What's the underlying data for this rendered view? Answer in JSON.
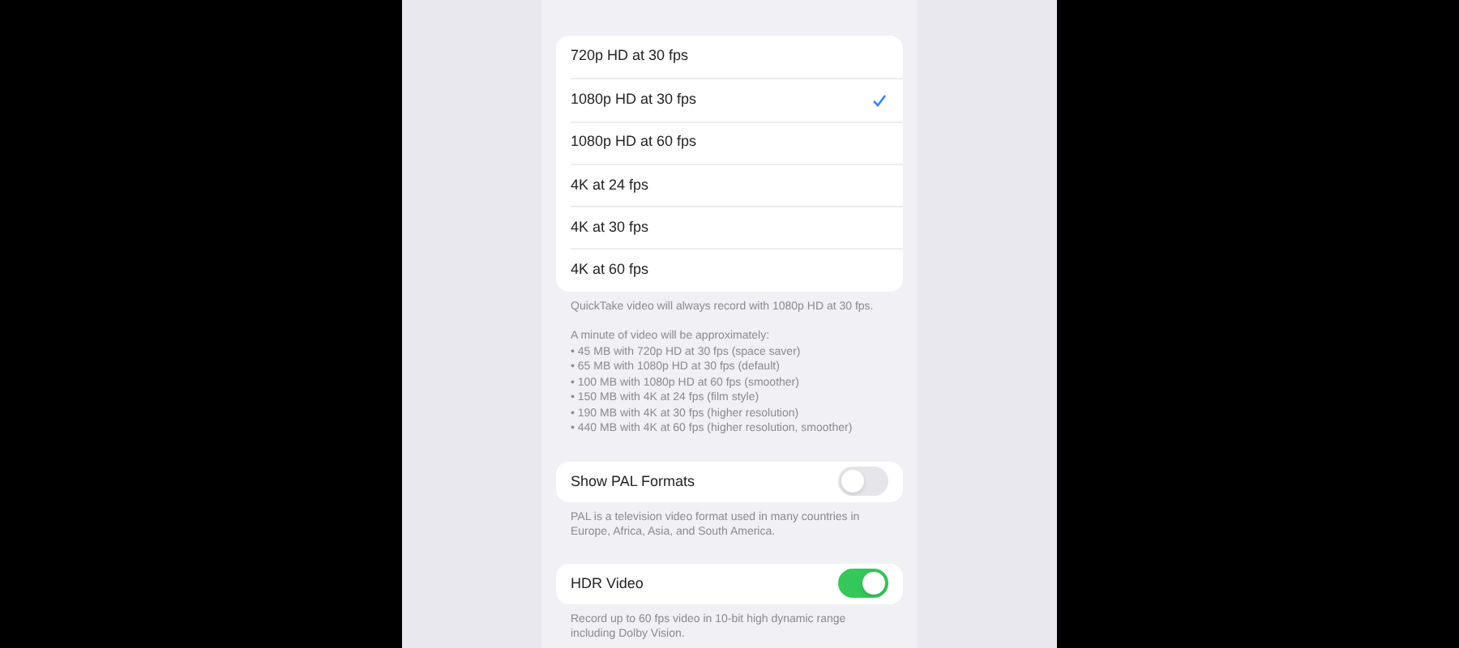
{
  "formats": [
    {
      "label": "720p HD at 30 fps",
      "selected": false
    },
    {
      "label": "1080p HD at 30 fps",
      "selected": true
    },
    {
      "label": "1080p HD at 60 fps",
      "selected": false
    },
    {
      "label": "4K at 24 fps",
      "selected": false
    },
    {
      "label": "4K at 30 fps",
      "selected": false
    },
    {
      "label": "4K at 60 fps",
      "selected": false
    }
  ],
  "formats_footer": {
    "note": "QuickTake video will always record with 1080p HD at 30 fps.",
    "intro": "A minute of video will be approximately:",
    "lines": [
      "• 45 MB with 720p HD at 30 fps (space saver)",
      "• 65 MB with 1080p HD at 30 fps (default)",
      "• 100 MB with 1080p HD at 60 fps (smoother)",
      "• 150 MB with 4K at 24 fps (film style)",
      "• 190 MB with 4K at 30 fps (higher resolution)",
      "• 440 MB with 4K at 60 fps (higher resolution, smoother)"
    ]
  },
  "toggles": [
    {
      "label": "Show PAL Formats",
      "on": false,
      "footer": "PAL is a television video format used in many countries in Europe, Africa, Asia, and South America."
    },
    {
      "label": "HDR Video",
      "on": true,
      "footer": "Record up to 60 fps video in 10-bit high dynamic range including Dolby Vision."
    }
  ]
}
